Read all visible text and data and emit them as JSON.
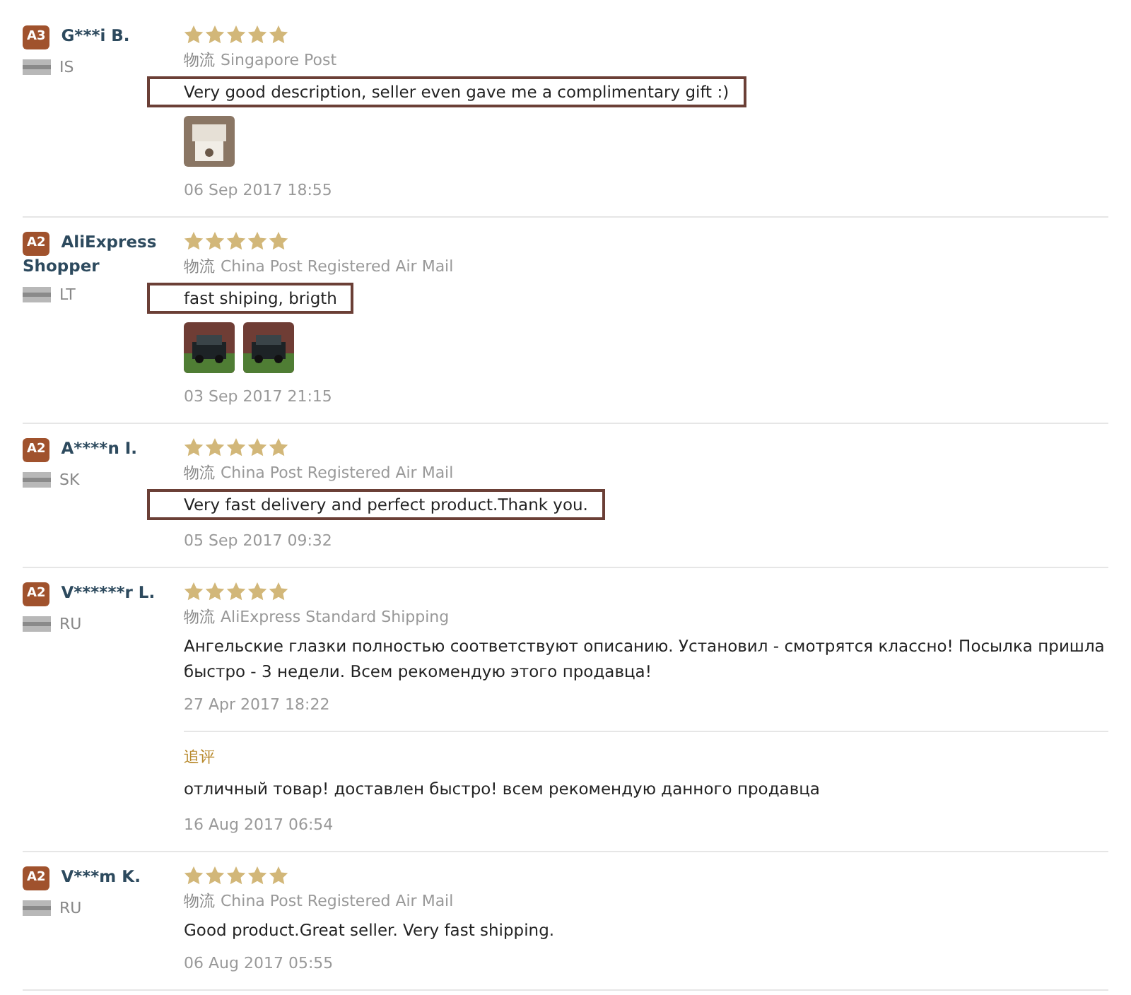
{
  "reviews": [
    {
      "badge": "A3",
      "name": "G***i B.",
      "country": "IS",
      "stars": 5,
      "shipping_label": "物流",
      "shipping": "Singapore Post",
      "text": "Very good description, seller even gave me a complimentary gift :)",
      "highlighted": true,
      "photos": [
        {
          "kind": "picture"
        }
      ],
      "date": "06 Sep 2017 18:55"
    },
    {
      "badge": "A2",
      "name": "AliExpress Shopper",
      "country": "LT",
      "stars": 5,
      "shipping_label": "物流",
      "shipping": "China Post Registered Air Mail",
      "text": "fast shiping, brigth",
      "highlighted": true,
      "photos": [
        {
          "kind": "picture"
        },
        {
          "kind": "picture"
        }
      ],
      "date": "03 Sep 2017 21:15"
    },
    {
      "badge": "A2",
      "name": "A****n I.",
      "country": "SK",
      "stars": 5,
      "shipping_label": "物流",
      "shipping": "China Post Registered Air Mail",
      "text": "Very fast delivery and perfect product.Thank you.",
      "highlighted": true,
      "date": "05 Sep 2017 09:32"
    },
    {
      "badge": "A2",
      "name": "V******r L.",
      "country": "RU",
      "stars": 5,
      "shipping_label": "物流",
      "shipping": "AliExpress Standard Shipping",
      "text": "Ангельские глазки полностью соответствуют описанию. Установил - смотрятся классно! Посылка пришла быстро - 3 недели. Всем рекомендую этого продавца!",
      "highlighted": false,
      "date": "27 Apr 2017 18:22",
      "followup": {
        "label": "追评",
        "text": "отличный товар! доставлен быстро! всем рекомендую данного продавца",
        "date": "16 Aug 2017 06:54"
      }
    },
    {
      "badge": "A2",
      "name": "V***m K.",
      "country": "RU",
      "stars": 5,
      "shipping_label": "物流",
      "shipping": "China Post Registered Air Mail",
      "text": "Good product.Great seller. Very fast shipping.",
      "highlighted": false,
      "date": "06 Aug 2017 05:55"
    }
  ]
}
